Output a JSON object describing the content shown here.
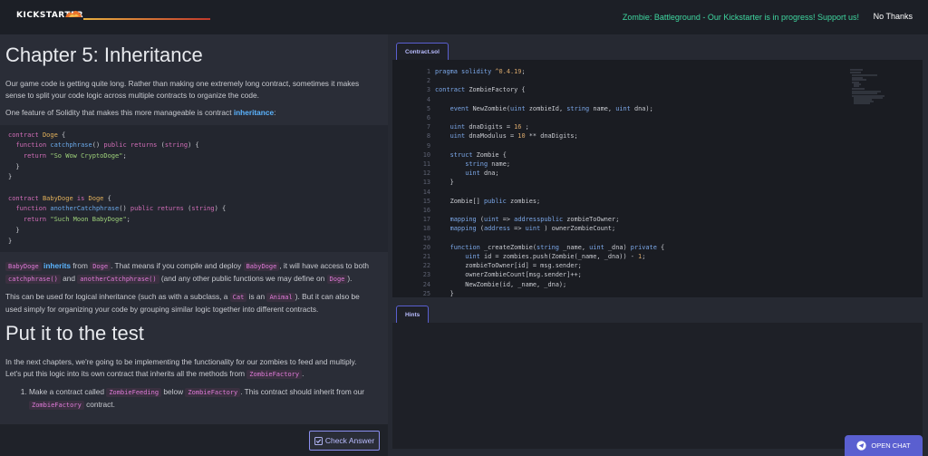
{
  "header": {
    "brand": "KICKSTARTER",
    "promo": "Zombie: Battleground - Our Kickstarter is in progress! Support us!",
    "no_thanks": "No Thanks"
  },
  "lesson": {
    "title": "Chapter 5: Inheritance",
    "p1": "Our game code is getting quite long. Rather than making one extremely long contract, sometimes it makes sense to split your code logic across multiple contracts to organize the code.",
    "p2_pre": "One feature of Solidity that makes this more manageable is contract ",
    "p2_kw": "inheritance",
    "p2_post": ":",
    "p3_a": "BabyDoge",
    "p3_kw": "inherits",
    "p3_b": " from ",
    "p3_c": "Doge",
    "p3_d": ". That means if you compile and deploy ",
    "p3_e": "BabyDoge",
    "p3_f": ", it will have access to both ",
    "p3_g": "catchphrase()",
    "p3_h": " and ",
    "p3_i": "anotherCatchphrase()",
    "p3_j": " (and any other public functions we may define on ",
    "p3_k": "Doge",
    "p3_l": ").",
    "p4_a": "This can be used for logical inheritance (such as with a subclass, a ",
    "p4_b": "Cat",
    "p4_c": " is an ",
    "p4_d": "Animal",
    "p4_e": "). But it can also be used simply for organizing your code by grouping similar logic together into different contracts.",
    "title2": "Put it to the test",
    "p5_a": "In the next chapters, we're going to be implementing the functionality for our zombies to feed and multiply. Let's put this logic into its own contract that inherits all the methods from ",
    "p5_b": "ZombieFactory",
    "p5_c": ".",
    "li1_a": "Make a contract called ",
    "li1_b": "ZombieFeeding",
    "li1_c": " below ",
    "li1_d": "ZombieFactory",
    "li1_e": ". This contract should inherit from our ",
    "li1_f": "ZombieFactory",
    "li1_g": " contract.",
    "check_answer": "Check Answer"
  },
  "example_code": [
    [
      [
        "c-k",
        "contract "
      ],
      [
        "c-t",
        "Doge"
      ],
      [
        "c-p",
        " {"
      ]
    ],
    [
      [
        "c-p",
        "  "
      ],
      [
        "c-k",
        "function "
      ],
      [
        "c-f",
        "catchphrase"
      ],
      [
        "c-p",
        "() "
      ],
      [
        "c-k",
        "public returns "
      ],
      [
        "c-p",
        "("
      ],
      [
        "c-k",
        "string"
      ],
      [
        "c-p",
        ") {"
      ]
    ],
    [
      [
        "c-p",
        "    "
      ],
      [
        "c-k",
        "return "
      ],
      [
        "c-s",
        "\"So Wow CryptoDoge\""
      ],
      [
        "c-p",
        ";"
      ]
    ],
    [
      [
        "c-p",
        "  }"
      ]
    ],
    [
      [
        "c-p",
        "}"
      ]
    ],
    [
      [
        "c-p",
        ""
      ]
    ],
    [
      [
        "c-k",
        "contract "
      ],
      [
        "c-t",
        "BabyDoge "
      ],
      [
        "c-k",
        "is "
      ],
      [
        "c-t",
        "Doge"
      ],
      [
        "c-p",
        " {"
      ]
    ],
    [
      [
        "c-p",
        "  "
      ],
      [
        "c-k",
        "function "
      ],
      [
        "c-f",
        "anotherCatchphrase"
      ],
      [
        "c-p",
        "() "
      ],
      [
        "c-k",
        "public returns "
      ],
      [
        "c-p",
        "("
      ],
      [
        "c-k",
        "string"
      ],
      [
        "c-p",
        ") {"
      ]
    ],
    [
      [
        "c-p",
        "    "
      ],
      [
        "c-k",
        "return "
      ],
      [
        "c-s",
        "\"Such Moon BabyDoge\""
      ],
      [
        "c-p",
        ";"
      ]
    ],
    [
      [
        "c-p",
        "  }"
      ]
    ],
    [
      [
        "c-p",
        "}"
      ]
    ]
  ],
  "editor": {
    "tab": "Contract.sol",
    "lines": [
      {
        "n": "1",
        "code": [
          [
            "e-k",
            "pragma solidity "
          ],
          [
            "e-n",
            "^0.4.19"
          ],
          [
            "",
            "; "
          ]
        ]
      },
      {
        "n": "2",
        "code": []
      },
      {
        "n": "3",
        "code": [
          [
            "e-k",
            "contract "
          ],
          [
            "",
            "ZombieFactory {"
          ]
        ]
      },
      {
        "n": "4",
        "code": []
      },
      {
        "n": "5",
        "code": [
          [
            "",
            "    "
          ],
          [
            "e-k",
            "event "
          ],
          [
            "",
            "NewZombie("
          ],
          [
            "e-t",
            "uint "
          ],
          [
            "",
            "zombieId, "
          ],
          [
            "e-t",
            "string "
          ],
          [
            "",
            "name, "
          ],
          [
            "e-t",
            "uint "
          ],
          [
            "",
            "dna);"
          ]
        ]
      },
      {
        "n": "6",
        "code": []
      },
      {
        "n": "7",
        "code": [
          [
            "",
            "    "
          ],
          [
            "e-t",
            "uint "
          ],
          [
            "",
            "dnaDigits = "
          ],
          [
            "e-n",
            "16"
          ],
          [
            "",
            " ;"
          ]
        ]
      },
      {
        "n": "8",
        "code": [
          [
            "",
            "    "
          ],
          [
            "e-t",
            "uint "
          ],
          [
            "",
            "dnaModulus = "
          ],
          [
            "e-n",
            "10 "
          ],
          [
            "",
            "** dnaDigits;"
          ]
        ]
      },
      {
        "n": "9",
        "code": []
      },
      {
        "n": "10",
        "code": [
          [
            "",
            "    "
          ],
          [
            "e-k",
            "struct "
          ],
          [
            "",
            "Zombie {"
          ]
        ]
      },
      {
        "n": "11",
        "code": [
          [
            "",
            "        "
          ],
          [
            "e-t",
            "string "
          ],
          [
            "",
            "name;"
          ]
        ]
      },
      {
        "n": "12",
        "code": [
          [
            "",
            "        "
          ],
          [
            "e-t",
            "uint "
          ],
          [
            "",
            "dna;"
          ]
        ]
      },
      {
        "n": "13",
        "code": [
          [
            "",
            "    }"
          ]
        ]
      },
      {
        "n": "14",
        "code": []
      },
      {
        "n": "15",
        "code": [
          [
            "",
            "    Zombie[] "
          ],
          [
            "e-k",
            "public "
          ],
          [
            "",
            "zombies;"
          ]
        ]
      },
      {
        "n": "16",
        "code": []
      },
      {
        "n": "17",
        "code": [
          [
            "",
            "    "
          ],
          [
            "e-k",
            "mapping "
          ],
          [
            "",
            "("
          ],
          [
            "e-t",
            "uint "
          ],
          [
            "",
            "=> "
          ],
          [
            "e-t",
            "address"
          ],
          [
            ") "
          ],
          [
            "e-k",
            "public "
          ],
          [
            "",
            "zombieToOwner;"
          ]
        ]
      },
      {
        "n": "18",
        "code": [
          [
            "",
            "    "
          ],
          [
            "e-k",
            "mapping "
          ],
          [
            "",
            "("
          ],
          [
            "e-t",
            "address "
          ],
          [
            "",
            "=> "
          ],
          [
            "e-t",
            "uint"
          ],
          [
            "",
            " ) ownerZombieCount;"
          ]
        ]
      },
      {
        "n": "19",
        "code": []
      },
      {
        "n": "20",
        "code": [
          [
            "",
            "    "
          ],
          [
            "e-k",
            "function "
          ],
          [
            "",
            "_createZombie("
          ],
          [
            "e-t",
            "string "
          ],
          [
            "",
            "_name, "
          ],
          [
            "e-t",
            "uint "
          ],
          [
            "",
            "_dna) "
          ],
          [
            "e-k",
            "private "
          ],
          [
            "",
            "{"
          ]
        ]
      },
      {
        "n": "21",
        "code": [
          [
            "",
            "        "
          ],
          [
            "e-t",
            "uint "
          ],
          [
            "",
            "id = zombies.push(Zombie(_name, _dna)) - "
          ],
          [
            "e-n",
            "1"
          ],
          [
            "",
            ";"
          ]
        ]
      },
      {
        "n": "22",
        "code": [
          [
            "",
            "        zombieToOwner[id] = msg.sender;"
          ]
        ]
      },
      {
        "n": "23",
        "code": [
          [
            "",
            "        ownerZombieCount[msg.sender]++;"
          ]
        ]
      },
      {
        "n": "24",
        "code": [
          [
            "",
            "        NewZombie(id, _name, _dna);"
          ]
        ]
      },
      {
        "n": "25",
        "code": [
          [
            "",
            "    }"
          ]
        ]
      }
    ]
  },
  "hints": {
    "tab": "Hints"
  },
  "chat": {
    "label": "OPEN CHAT"
  },
  "colors": {
    "accent": "#5a5fd0",
    "promo": "#3fd7a0",
    "inline_code": "#e07ad8"
  }
}
